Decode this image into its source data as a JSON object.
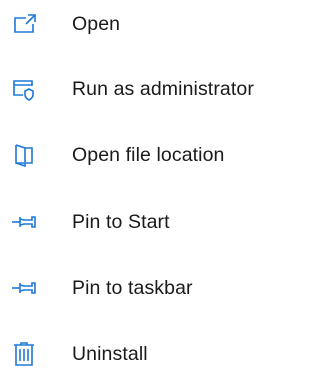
{
  "menu": {
    "accent_color": "#1e78d7",
    "items": [
      {
        "label": "Open",
        "icon": "open-icon"
      },
      {
        "label": "Run as administrator",
        "icon": "shield-icon"
      },
      {
        "label": "Open file location",
        "icon": "folder-location-icon"
      },
      {
        "label": "Pin to Start",
        "icon": "pin-icon"
      },
      {
        "label": "Pin to taskbar",
        "icon": "pin-icon"
      },
      {
        "label": "Uninstall",
        "icon": "trash-icon"
      }
    ]
  }
}
